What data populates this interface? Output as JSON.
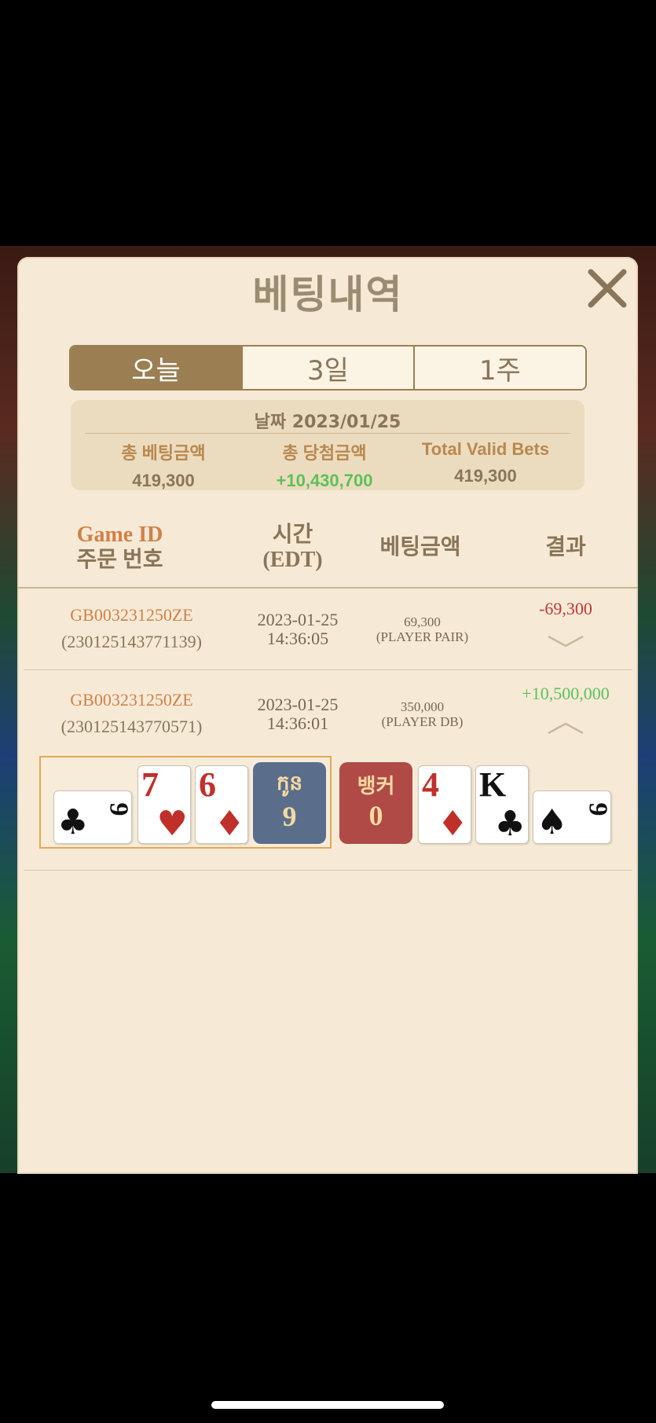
{
  "title": "베팅내역",
  "tabs": [
    {
      "label": "오늘",
      "active": true
    },
    {
      "label": "3일",
      "active": false
    },
    {
      "label": "1주",
      "active": false
    }
  ],
  "summary": {
    "date_label": "날짜 2023/01/25",
    "total_bet_label": "총 베팅금액",
    "total_bet_value": "419,300",
    "total_win_label": "총 당첨금액",
    "total_win_value": "+10,430,700",
    "valid_label": "Total Valid Bets",
    "valid_value": "419,300"
  },
  "headers": {
    "game_id": "Game ID",
    "order_no": "주문 번호",
    "time_1": "시간",
    "time_2": "(EDT)",
    "amount": "베팅금액",
    "result": "결과"
  },
  "rows": [
    {
      "game_id": "GB003231250ZE",
      "order_no": "(230125143771139)",
      "date": "2023-01-25",
      "time": "14:36:05",
      "amount": "69,300",
      "bet_type": "(PLAYER PAIR)",
      "result": "-69,300",
      "expanded": false
    },
    {
      "game_id": "GB003231250ZE",
      "order_no": "(230125143770571)",
      "date": "2023-01-25",
      "time": "14:36:01",
      "amount": "350,000",
      "bet_type": "(PLAYER DB)",
      "result": "+10,500,000",
      "expanded": true
    }
  ],
  "player_hand": {
    "label": "កូន",
    "score": "9",
    "cards": [
      {
        "rank": "9",
        "suit": "clubs",
        "color": "black",
        "rotated": true
      },
      {
        "rank": "7",
        "suit": "hearts",
        "color": "red"
      },
      {
        "rank": "6",
        "suit": "diamonds",
        "color": "red"
      }
    ]
  },
  "banker_hand": {
    "label": "뱅커",
    "score": "0",
    "cards": [
      {
        "rank": "4",
        "suit": "diamonds",
        "color": "red"
      },
      {
        "rank": "K",
        "suit": "clubs",
        "color": "black"
      },
      {
        "rank": "9",
        "suit": "spades",
        "color": "black",
        "rotated": true
      }
    ]
  },
  "colors": {
    "modal_bg": "#f6ead6",
    "accent_brown": "#9b7e52",
    "game_id_orange": "#d2804a",
    "loss_red": "#c0383a",
    "win_green": "#5ec05a",
    "player_badge": "#5a6e8c",
    "banker_badge": "#b04a46"
  }
}
